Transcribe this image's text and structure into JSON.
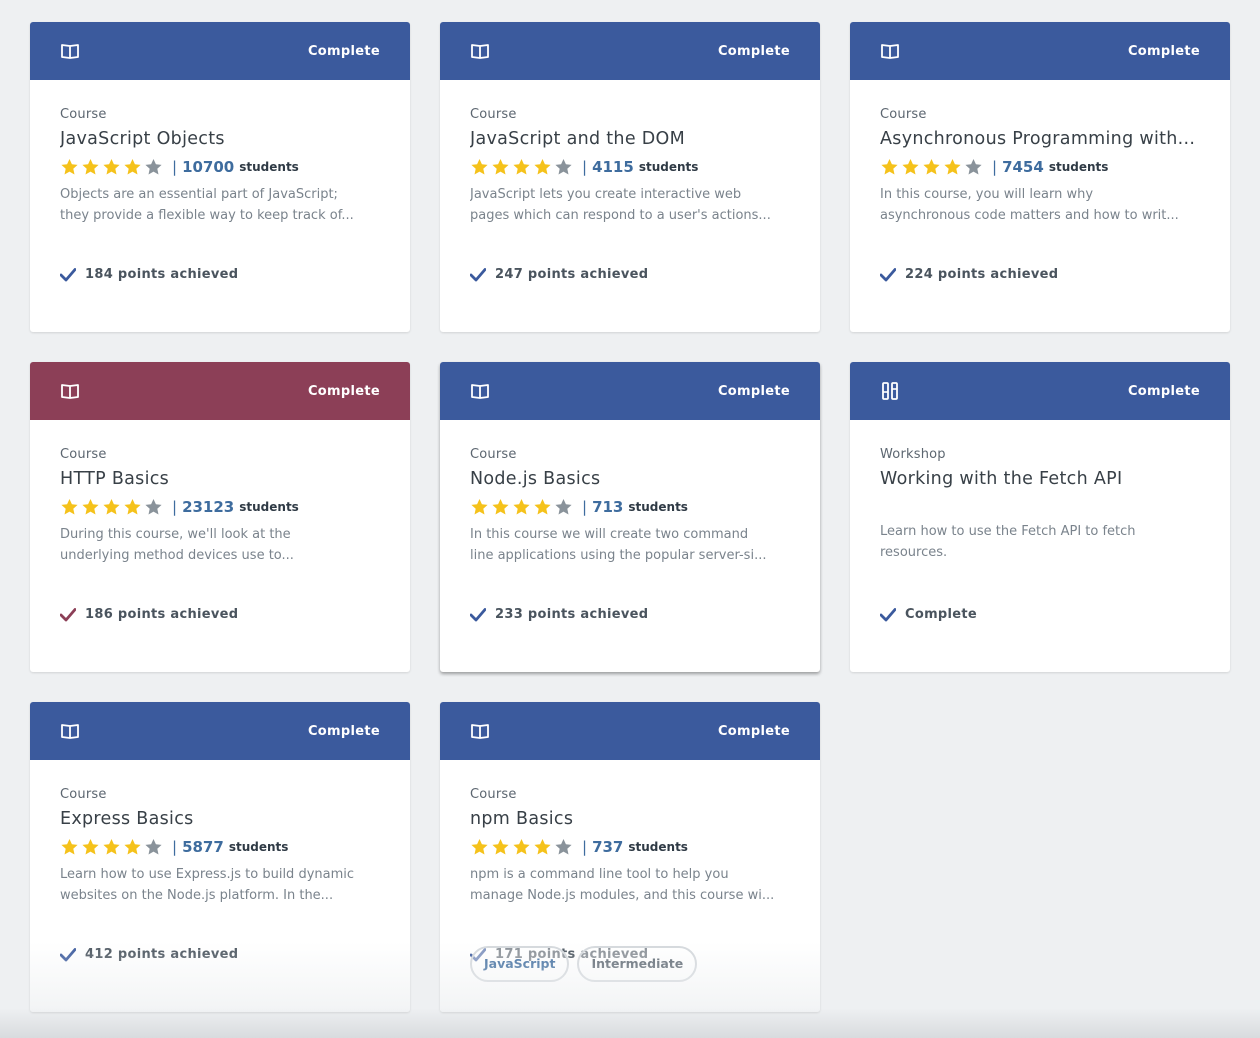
{
  "colors": {
    "blue_header": "#3b5a9d",
    "red_header": "#8c3f57",
    "star_filled": "#f5c21b",
    "star_empty": "#8a939b",
    "link_blue": "#3e6c9e"
  },
  "students_label": "students",
  "cards": [
    {
      "header_color": "#3b5a9d",
      "icon": "book-icon",
      "status": "Complete",
      "type": "Course",
      "title": "JavaScript Objects",
      "rating": 4,
      "divider": "|",
      "student_count": "10700",
      "desc_line1": "Objects are an essential part of JavaScript;",
      "desc_line2": "they provide a flexible way to keep track of...",
      "footer": "184 points achieved"
    },
    {
      "header_color": "#3b5a9d",
      "icon": "book-icon",
      "status": "Complete",
      "type": "Course",
      "title": "JavaScript and the DOM",
      "rating": 4,
      "divider": "|",
      "student_count": "4115",
      "desc_line1": "JavaScript lets you create interactive web",
      "desc_line2": "pages which can respond to a user's actions...",
      "footer": "247 points achieved"
    },
    {
      "header_color": "#3b5a9d",
      "icon": "book-icon",
      "status": "Complete",
      "type": "Course",
      "title": "Asynchronous Programming with...",
      "rating": 4,
      "divider": "|",
      "student_count": "7454",
      "desc_line1": "In this course, you will learn why",
      "desc_line2": "asynchronous code matters and how to writ...",
      "footer": "224 points achieved"
    },
    {
      "header_color": "#8c3f57",
      "icon": "book-icon",
      "status": "Complete",
      "type": "Course",
      "title": "HTTP Basics",
      "rating": 4,
      "divider": "|",
      "student_count": "23123",
      "desc_line1": "During this course, we'll look at the",
      "desc_line2": "underlying method devices use to...",
      "footer": "186 points achieved"
    },
    {
      "header_color": "#3b5a9d",
      "icon": "book-icon",
      "status": "Complete",
      "type": "Course",
      "title": "Node.js Basics",
      "rating": 4,
      "divider": "|",
      "student_count": "713",
      "desc_line1": "In this course we will create two command",
      "desc_line2": "line applications using the popular server-si...",
      "footer": "233 points achieved"
    },
    {
      "header_color": "#3b5a9d",
      "icon": "workshop-icon",
      "status": "Complete",
      "type": "Workshop",
      "title": "Working with the Fetch API",
      "rating": null,
      "divider": "",
      "student_count": "",
      "desc_line1": "Learn how to use the Fetch API to fetch",
      "desc_line2": "resources.",
      "footer": "Complete"
    },
    {
      "header_color": "#3b5a9d",
      "icon": "book-icon",
      "status": "Complete",
      "type": "Course",
      "title": "Express Basics",
      "rating": 4,
      "divider": "|",
      "student_count": "5877",
      "desc_line1": "Learn how to use Express.js to build dynamic",
      "desc_line2": "websites on the Node.js platform. In the...",
      "footer": "412 points achieved"
    },
    {
      "header_color": "#3b5a9d",
      "icon": "book-icon",
      "status": "Complete",
      "type": "Course",
      "title": "npm Basics",
      "rating": 4,
      "divider": "|",
      "student_count": "737",
      "desc_line1": "npm is a command line tool to help you",
      "desc_line2": "manage Node.js modules, and this course wi...",
      "footer": "171 points achieved",
      "tags": [
        "JavaScript",
        "Intermediate"
      ]
    }
  ]
}
